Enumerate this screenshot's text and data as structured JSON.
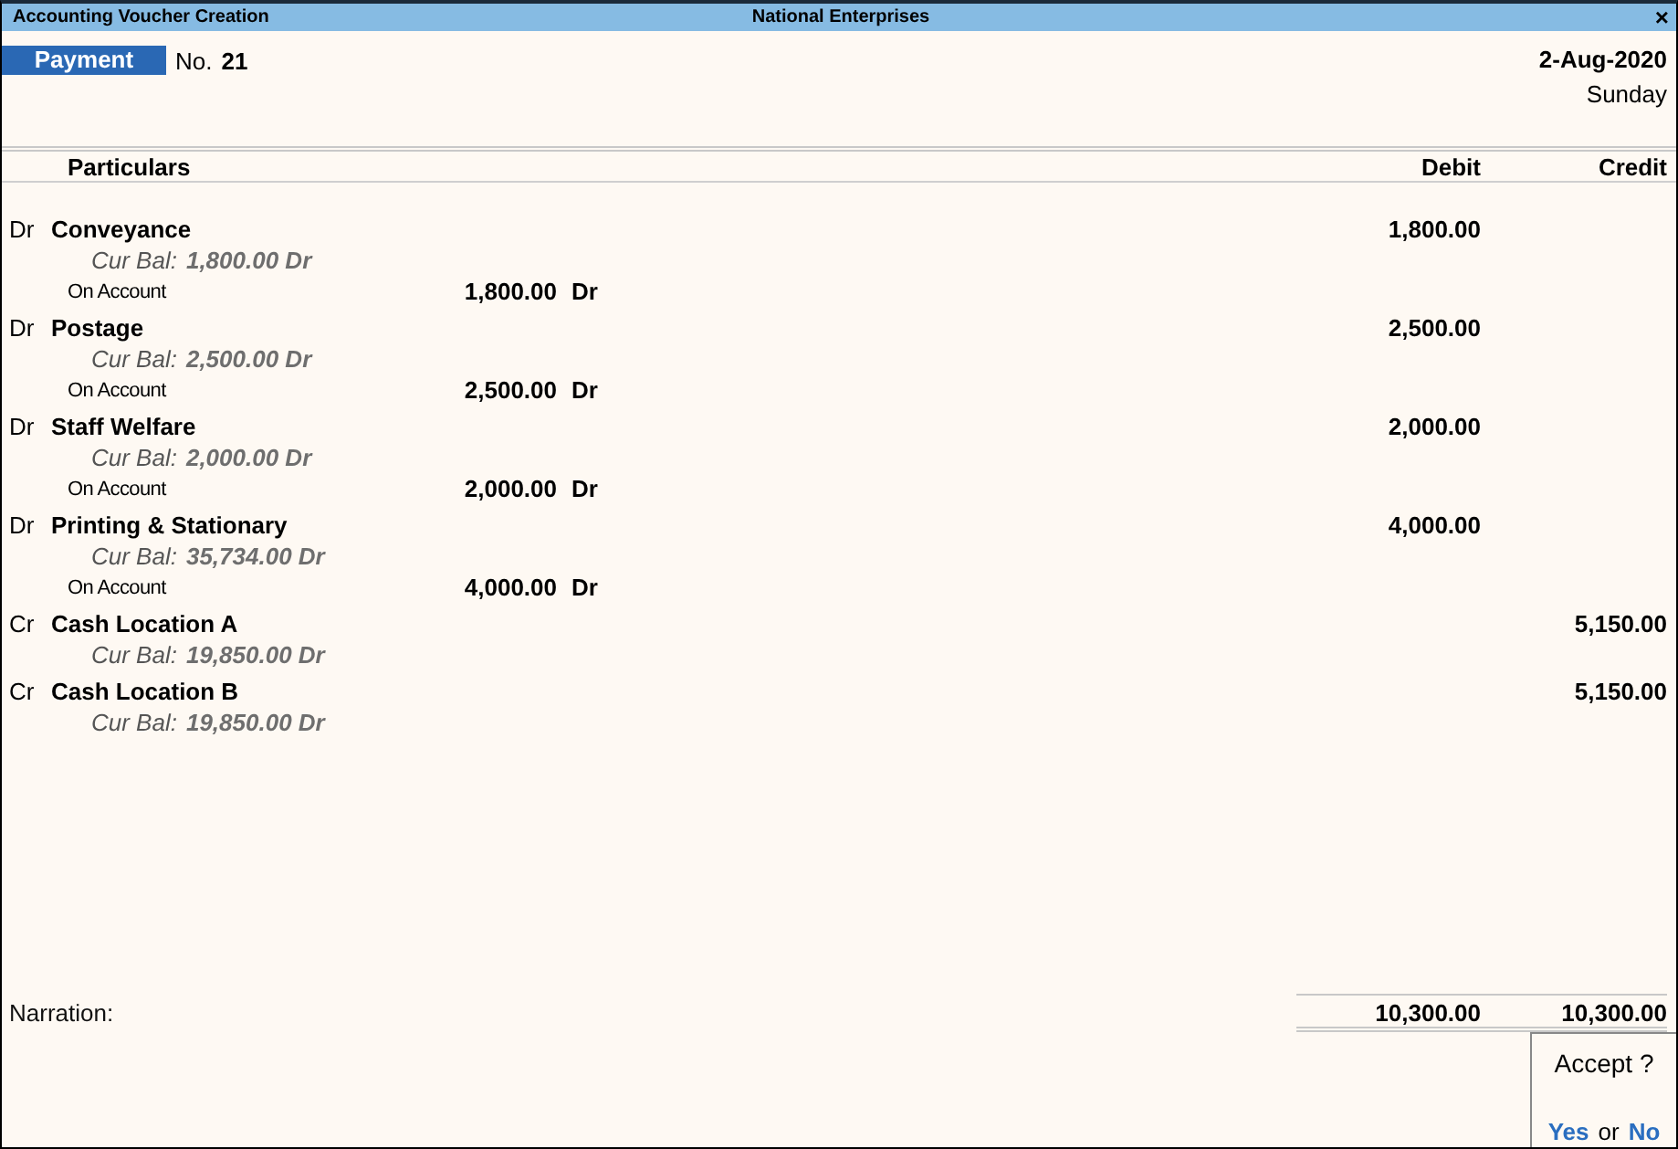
{
  "window": {
    "title": "Accounting Voucher Creation",
    "company": "National Enterprises",
    "close": "×"
  },
  "voucher": {
    "type": "Payment",
    "number_label": "No.",
    "number": "21",
    "date": "2-Aug-2020",
    "day": "Sunday"
  },
  "columns": [
    "Particulars",
    "Debit",
    "Credit"
  ],
  "entries": [
    {
      "side": "Dr",
      "ledger": "Conveyance",
      "cur_bal_label": "Cur Bal:",
      "cur_bal": "1,800.00 Dr",
      "bill": {
        "label": "On Account",
        "amount": "1,800.00",
        "side": "Dr"
      },
      "debit": "1,800.00"
    },
    {
      "side": "Dr",
      "ledger": "Postage",
      "cur_bal_label": "Cur Bal:",
      "cur_bal": "2,500.00 Dr",
      "bill": {
        "label": "On Account",
        "amount": "2,500.00",
        "side": "Dr"
      },
      "debit": "2,500.00"
    },
    {
      "side": "Dr",
      "ledger": "Staff Welfare",
      "cur_bal_label": "Cur Bal:",
      "cur_bal": "2,000.00 Dr",
      "bill": {
        "label": "On Account",
        "amount": "2,000.00",
        "side": "Dr"
      },
      "debit": "2,000.00"
    },
    {
      "side": "Dr",
      "ledger": "Printing & Stationary",
      "cur_bal_label": "Cur Bal:",
      "cur_bal": "35,734.00 Dr",
      "bill": {
        "label": "On Account",
        "amount": "4,000.00",
        "side": "Dr"
      },
      "debit": "4,000.00"
    },
    {
      "side": "Cr",
      "ledger": "Cash Location A",
      "cur_bal_label": "Cur Bal:",
      "cur_bal": "19,850.00 Dr",
      "credit": "5,150.00"
    },
    {
      "side": "Cr",
      "ledger": "Cash Location B",
      "cur_bal_label": "Cur Bal:",
      "cur_bal": "19,850.00 Dr",
      "credit": "5,150.00"
    }
  ],
  "narration_label": "Narration:",
  "totals": {
    "debit": "10,300.00",
    "credit": "10,300.00"
  },
  "dialog": {
    "question": "Accept ?",
    "yes": "Yes",
    "or": "or",
    "no": "No"
  }
}
